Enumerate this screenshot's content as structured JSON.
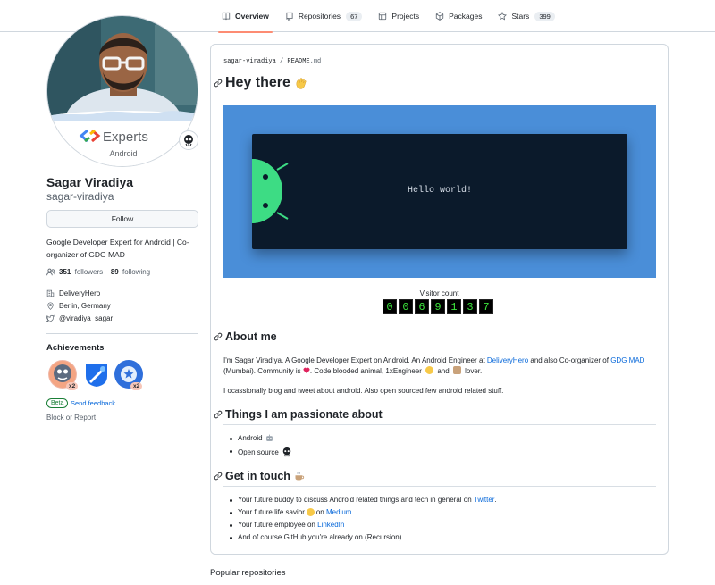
{
  "nav": {
    "tabs": [
      {
        "label": "Overview",
        "icon": "book-icon",
        "active": true
      },
      {
        "label": "Repositories",
        "count": "67",
        "icon": "repo-icon"
      },
      {
        "label": "Projects",
        "icon": "table-icon"
      },
      {
        "label": "Packages",
        "icon": "package-icon"
      },
      {
        "label": "Stars",
        "count": "399",
        "icon": "star-icon"
      }
    ]
  },
  "profile": {
    "avatar_badge_text": "Experts",
    "avatar_badge_subtext": "Android",
    "name": "Sagar Viradiya",
    "login": "sagar-viradiya",
    "follow_label": "Follow",
    "bio": "Google Developer Expert for Android | Co-organizer of GDG MAD",
    "followers_count": "351",
    "followers_label": "followers",
    "following_count": "89",
    "following_label": "following",
    "company": "DeliveryHero",
    "location": "Berlin, Germany",
    "twitter": "@viradiya_sagar"
  },
  "achievements": {
    "title": "Achievements",
    "badges": [
      {
        "name": "pull-shark",
        "count": "x2"
      },
      {
        "name": "yolo",
        "count": ""
      },
      {
        "name": "starstruck",
        "count": "x2"
      }
    ],
    "beta_label": "Beta",
    "feedback_label": "Send feedback",
    "block_report": "Block or Report"
  },
  "readme": {
    "path_user": "sagar-viradiya",
    "path_sep": "/",
    "path_file": "README",
    "path_ext": ".md",
    "title": "Hey there",
    "banner_text": "Hello world!",
    "visitor_label": "Visitor count",
    "visitor_digits": [
      "0",
      "0",
      "6",
      "9",
      "1",
      "3",
      "7"
    ],
    "about_title": "About me",
    "about_p1_a": "I'm Sagar Viradiya. A Google Developer Expert on Android. An Android Engineer at ",
    "about_p1_link1": "DeliveryHero",
    "about_p1_b": " and also Co-organizer of ",
    "about_p1_link2": "GDG MAD",
    "about_p1_c": "(Mumbai). Community is ",
    "about_p1_d": ". Code blooded animal, 1xEngineer ",
    "about_p1_e": " and ",
    "about_p1_f": " lover.",
    "about_p2": "I ocassionally blog and tweet about android. Also open sourced few android related stuff.",
    "passion_title": "Things I am passionate about",
    "passion_items": [
      "Android",
      "Open source"
    ],
    "touch_title": "Get in touch",
    "touch_1_a": "Your future buddy to discuss Android related things and tech in general on ",
    "touch_1_link": "Twitter",
    "touch_1_b": ".",
    "touch_2_a": "Your future life savior ",
    "touch_2_b": " on ",
    "touch_2_link": "Medium",
    "touch_2_c": ".",
    "touch_3_a": "Your future employee on ",
    "touch_3_link": "LinkedIn",
    "touch_4": "And of course GitHub you're already on (Recursion)."
  },
  "popular_repos_title": "Popular repositories",
  "colors": {
    "accent": "#fd8c73",
    "link": "#0969da",
    "banner": "#4a8ed8",
    "terminal": "#0b1a2b",
    "android": "#3ddc84"
  }
}
